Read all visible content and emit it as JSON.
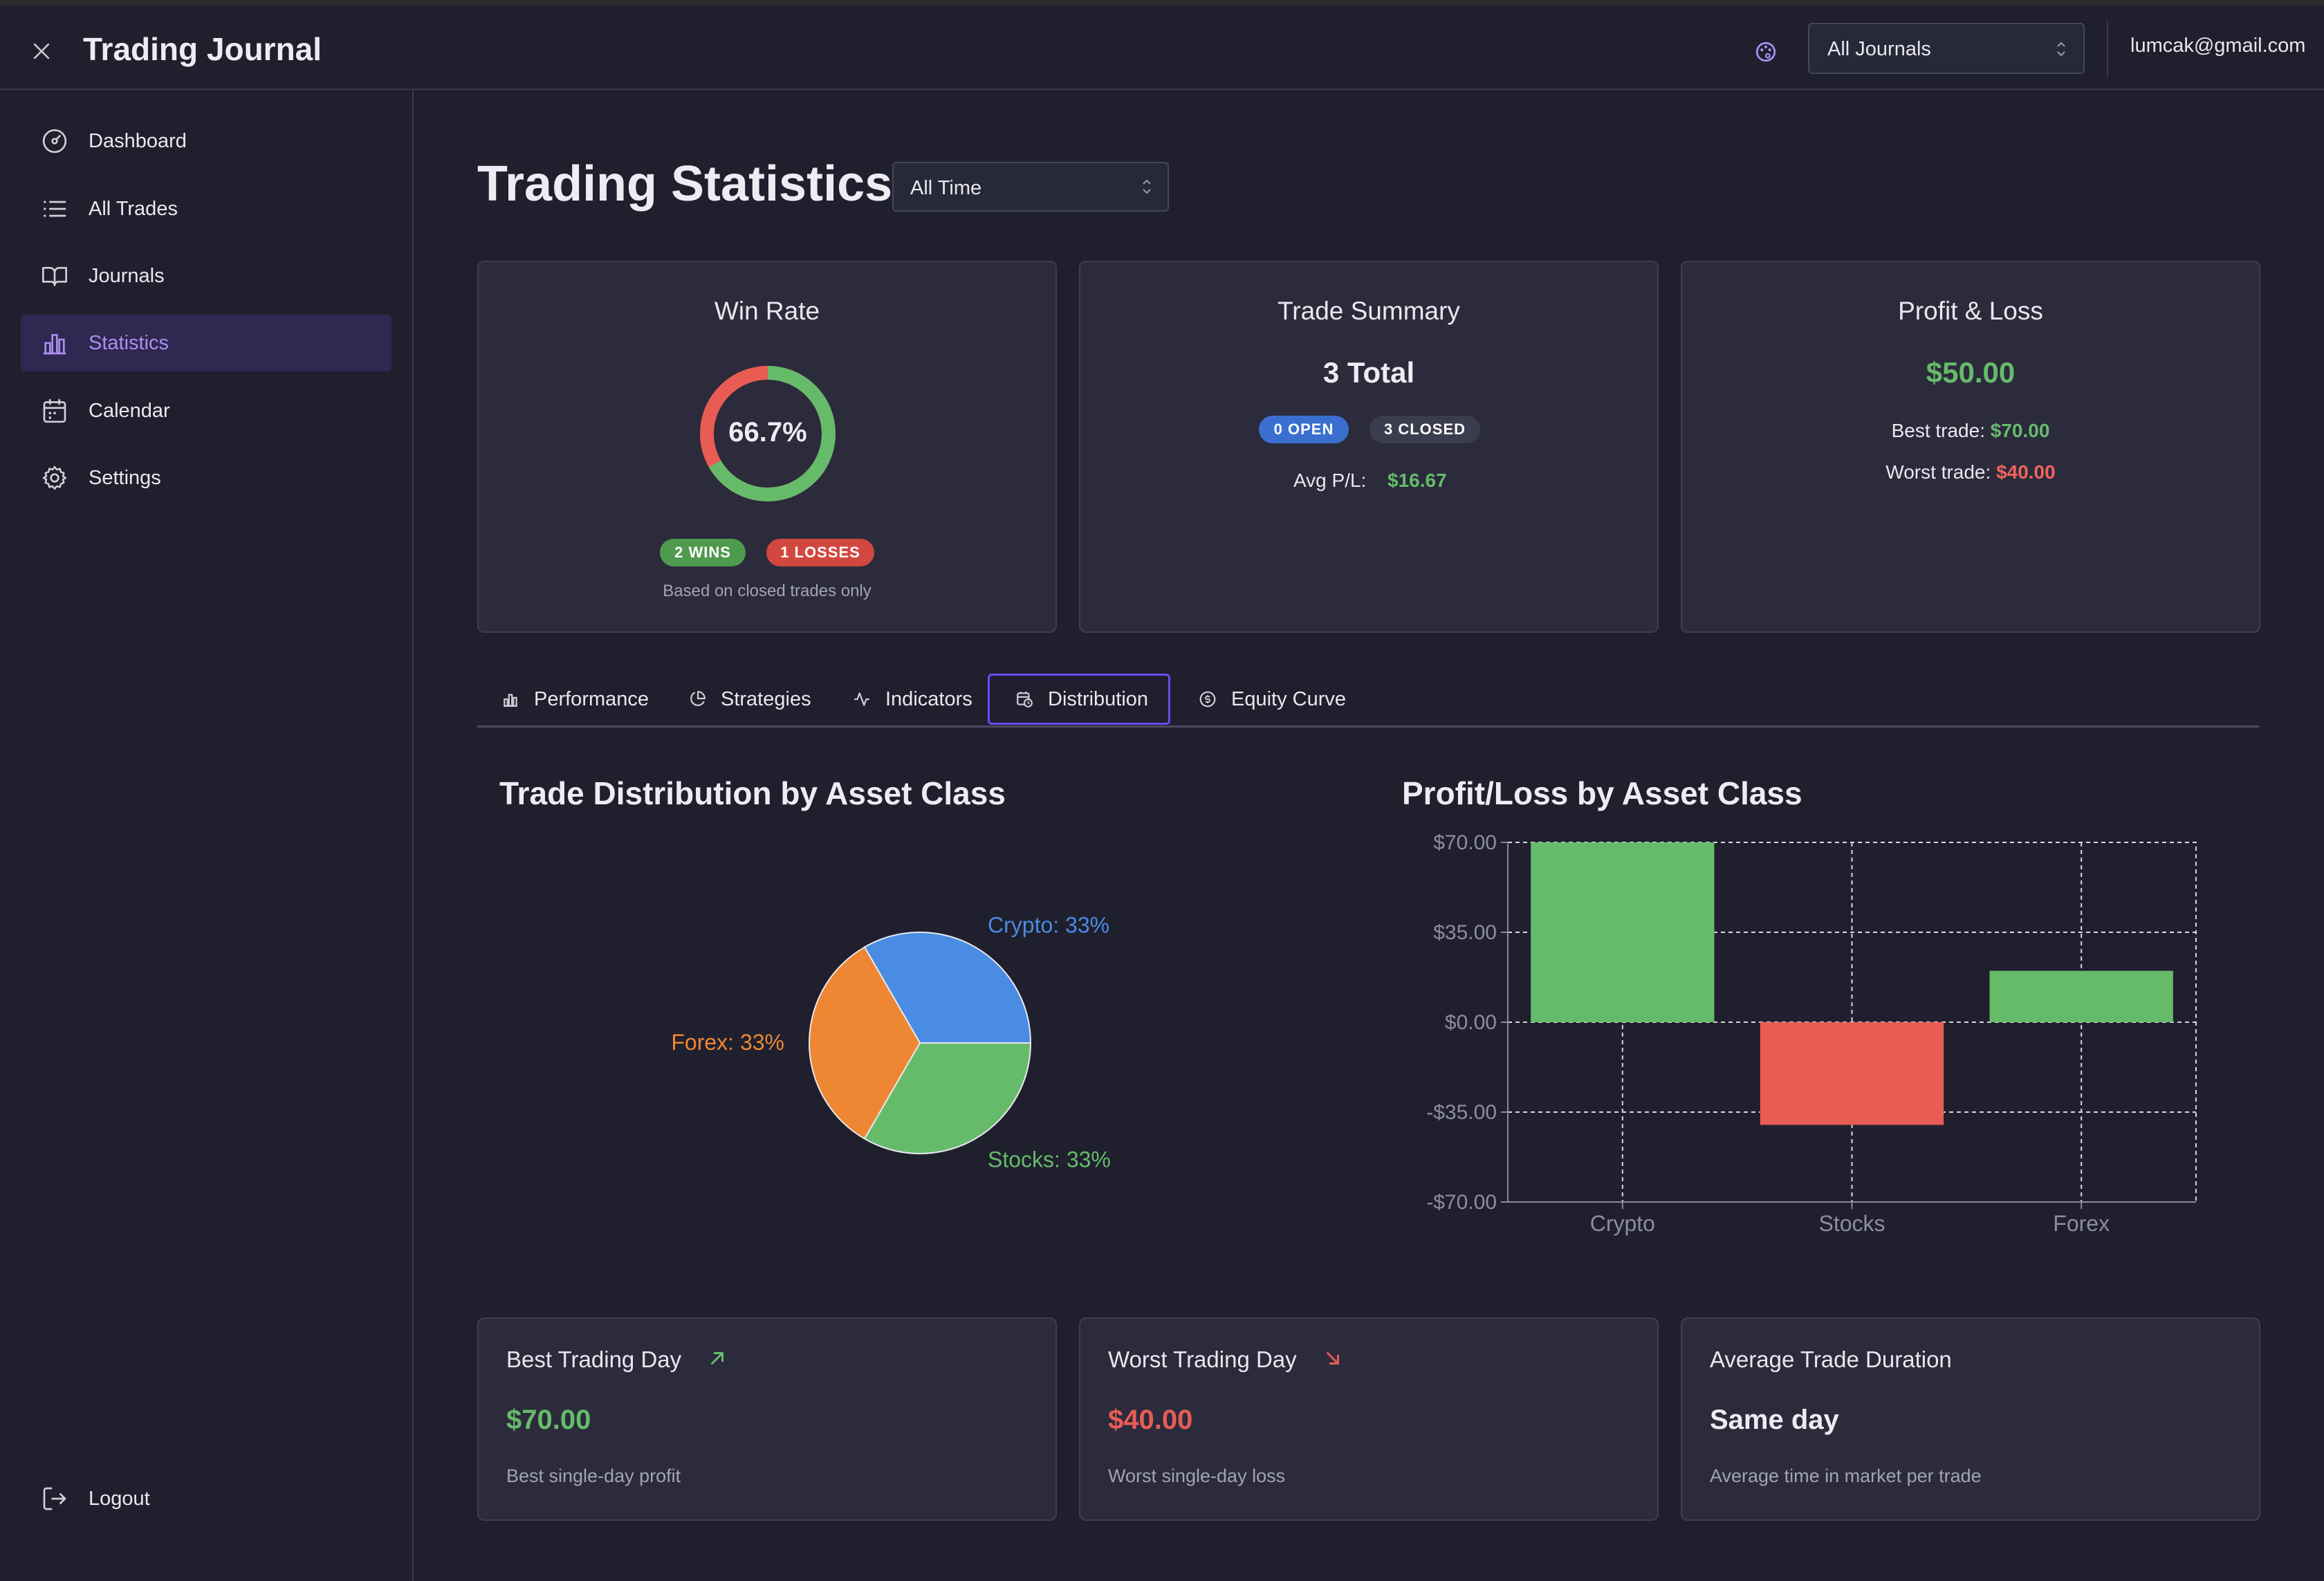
{
  "app": {
    "title": "Trading Journal",
    "user_email": "lumcak@gmail.com"
  },
  "journal_select": {
    "value": "All Journals"
  },
  "sidebar": {
    "items": [
      {
        "label": "Dashboard",
        "icon": "dashboard-icon"
      },
      {
        "label": "All Trades",
        "icon": "list-icon"
      },
      {
        "label": "Journals",
        "icon": "book-icon"
      },
      {
        "label": "Statistics",
        "icon": "bar-chart-icon",
        "active": true
      },
      {
        "label": "Calendar",
        "icon": "calendar-icon"
      },
      {
        "label": "Settings",
        "icon": "gear-icon"
      }
    ],
    "logout_label": "Logout"
  },
  "page": {
    "title": "Trading Statistics",
    "time_filter": "All Time"
  },
  "win_rate": {
    "title": "Win Rate",
    "percent": 66.7,
    "percent_label": "66.7%",
    "wins_label": "2 WINS",
    "losses_label": "1 LOSSES",
    "note": "Based on closed trades only"
  },
  "trade_summary": {
    "title": "Trade Summary",
    "total": "3 Total",
    "open_label": "0 OPEN",
    "closed_label": "3 CLOSED",
    "avg_label": "Avg P/L:",
    "avg_value": "$16.67"
  },
  "profit_loss": {
    "title": "Profit & Loss",
    "total": "$50.00",
    "best_label": "Best trade:",
    "best_value": "$70.00",
    "worst_label": "Worst trade:",
    "worst_value": "$40.00"
  },
  "tabs": [
    {
      "label": "Performance",
      "icon": "bar-chart-icon"
    },
    {
      "label": "Strategies",
      "icon": "pie-chart-icon"
    },
    {
      "label": "Indicators",
      "icon": "activity-icon"
    },
    {
      "label": "Distribution",
      "icon": "calendar-clock-icon",
      "active": true
    },
    {
      "label": "Equity Curve",
      "icon": "dollar-circle-icon"
    }
  ],
  "colors": {
    "green": "#66bb6a",
    "red": "#e85c54",
    "blue": "#4a8be3",
    "orange": "#ee8733",
    "accent": "#a98ef0",
    "badge_blue": "#3a6fd0",
    "badge_gray": "#3b3c4e"
  },
  "chart_data": [
    {
      "type": "pie",
      "title": "Trade Distribution by Asset Class",
      "slices": [
        {
          "label": "Crypto",
          "value": 33,
          "text": "Crypto: 33%",
          "color": "#4a8be3"
        },
        {
          "label": "Forex",
          "value": 33,
          "text": "Forex: 33%",
          "color": "#ee8733"
        },
        {
          "label": "Stocks",
          "value": 33,
          "text": "Stocks: 33%",
          "color": "#66bb6a"
        }
      ]
    },
    {
      "type": "bar",
      "title": "Profit/Loss by Asset Class",
      "categories": [
        "Crypto",
        "Stocks",
        "Forex"
      ],
      "values": [
        70,
        -40,
        20
      ],
      "colors": [
        "#66bb6a",
        "#e85c54",
        "#66bb6a"
      ],
      "ylim": [
        -70,
        70
      ],
      "yticks": [
        70,
        35,
        0,
        -35,
        -70
      ],
      "ytick_labels": [
        "$70.00",
        "$35.00",
        "$0.00",
        "-$35.00",
        "-$70.00"
      ],
      "grid": true
    }
  ],
  "bottom_stats": [
    {
      "title": "Best Trading Day",
      "value": "$70.00",
      "desc": "Best single-day profit",
      "icon": "trend-up-arrow-icon"
    },
    {
      "title": "Worst Trading Day",
      "value": "$40.00",
      "desc": "Worst single-day loss",
      "icon": "trend-down-arrow-icon"
    },
    {
      "title": "Average Trade Duration",
      "value": "Same day",
      "desc": "Average time in market per trade",
      "icon": ""
    }
  ]
}
